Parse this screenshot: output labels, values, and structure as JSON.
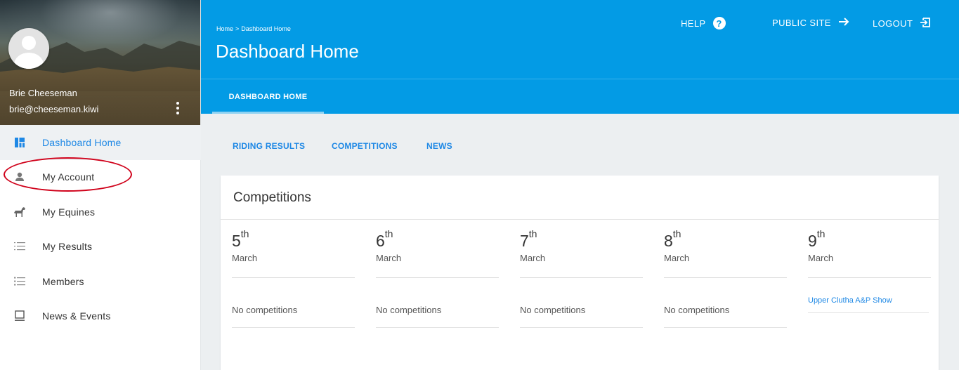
{
  "user": {
    "name": "Brie Cheeseman",
    "email": "brie@cheeseman.kiwi"
  },
  "sidebar": {
    "items": [
      {
        "label": "Dashboard Home",
        "icon": "dashboard-icon",
        "active": true
      },
      {
        "label": "My Account",
        "icon": "person-icon",
        "active": false
      },
      {
        "label": "My Equines",
        "icon": "horse-icon",
        "active": false
      },
      {
        "label": "My Results",
        "icon": "numbered-list-icon",
        "active": false
      },
      {
        "label": "Members",
        "icon": "bulleted-list-icon",
        "active": false
      },
      {
        "label": "News & Events",
        "icon": "monitor-icon",
        "active": false
      }
    ]
  },
  "header": {
    "breadcrumb": {
      "home": "Home",
      "separator": ">",
      "current": "Dashboard Home"
    },
    "title": "Dashboard Home",
    "help": "HELP",
    "public_site": "PUBLIC SITE",
    "logout": "LOGOUT",
    "tab": "DASHBOARD HOME"
  },
  "sub_tabs": [
    "RIDING RESULTS",
    "COMPETITIONS",
    "NEWS"
  ],
  "competitions": {
    "title": "Competitions",
    "days": [
      {
        "day": "5",
        "suffix": "th",
        "month": "March",
        "status": "No competitions",
        "is_link": false
      },
      {
        "day": "6",
        "suffix": "th",
        "month": "March",
        "status": "No competitions",
        "is_link": false
      },
      {
        "day": "7",
        "suffix": "th",
        "month": "March",
        "status": "No competitions",
        "is_link": false
      },
      {
        "day": "8",
        "suffix": "th",
        "month": "March",
        "status": "No competitions",
        "is_link": false
      },
      {
        "day": "9",
        "suffix": "th",
        "month": "March",
        "status": "Upper Clutha A&P Show",
        "is_link": true
      }
    ]
  },
  "colors": {
    "primary": "#039be5",
    "link": "#1e88e5",
    "annotation": "#d0021b",
    "background": "#eceff1"
  }
}
